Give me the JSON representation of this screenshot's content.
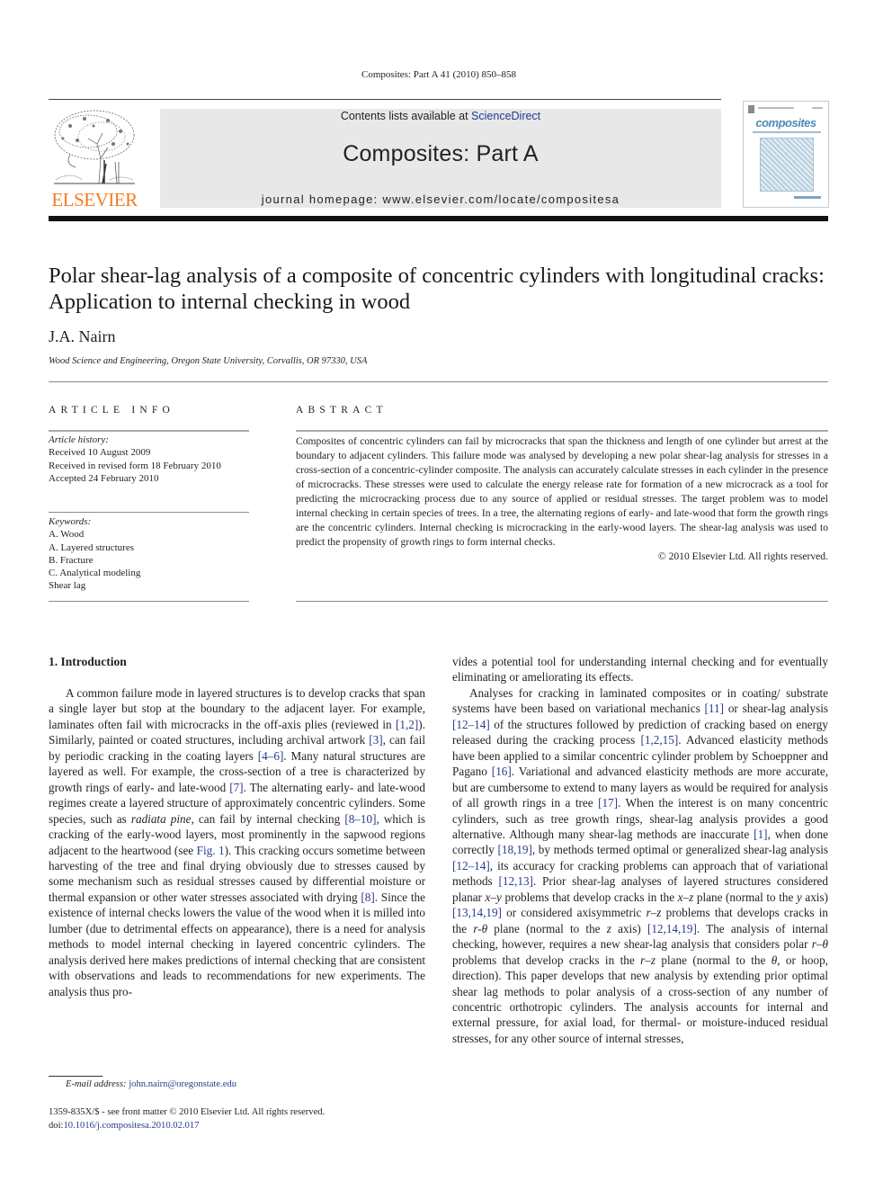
{
  "running_head": "Composites: Part A 41 (2010) 850–858",
  "header": {
    "publisher_logo_text": "ELSEVIER",
    "contents_prefix": "Contents lists available at ",
    "contents_link": "ScienceDirect",
    "journal_name": "Composites: Part A",
    "homepage": "journal homepage: www.elsevier.com/locate/compositesa",
    "cover_title": "composites",
    "colors": {
      "elsevier_orange": "#f47b20",
      "link_blue": "#2a3a8c",
      "banner_gray": "#e8e8e8"
    }
  },
  "article": {
    "title": "Polar shear-lag analysis of a composite of concentric cylinders with longitudinal cracks: Application to internal checking in wood",
    "author": "J.A. Nairn",
    "affiliation": "Wood Science and Engineering, Oregon State University, Corvallis, OR 97330, USA"
  },
  "article_info": {
    "heading": "ARTICLE INFO",
    "history_label": "Article history:",
    "history": [
      "Received 10 August 2009",
      "Received in revised form 18 February 2010",
      "Accepted 24 February 2010"
    ],
    "keywords_label": "Keywords:",
    "keywords": [
      "A. Wood",
      "A. Layered structures",
      "B. Fracture",
      "C. Analytical modeling",
      "Shear lag"
    ]
  },
  "abstract": {
    "heading": "ABSTRACT",
    "text": "Composites of concentric cylinders can fail by microcracks that span the thickness and length of one cyl­inder but arrest at the boundary to adjacent cylinders. This failure mode was analysed by developing a new polar shear-lag analysis for stresses in a cross-section of a concentric-cylinder composite. The anal­ysis can accurately calculate stresses in each cylinder in the presence of microcracks. These stresses were used to calculate the energy release rate for formation of a new microcrack as a tool for predicting the microcracking process due to any source of applied or residual stresses. The target problem was to model internal checking in certain species of trees. In a tree, the alternating regions of early- and late-wood that form the growth rings are the concentric cylinders. Internal checking is microcracking in the early-wood layers. The shear-lag analysis was used to predict the propensity of growth rings to form internal checks.",
    "copyright": "© 2010 Elsevier Ltd. All rights reserved."
  },
  "introduction": {
    "heading": "1. Introduction",
    "left_col": {
      "p1_a": "A common failure mode in layered structures is to develop cracks that span a single layer but stop at the boundary to the adja­cent layer. For example, laminates often fail with microcracks in the off-axis plies (reviewed in ",
      "ref1": "[1,2]",
      "p1_b": "). Similarly, painted or coated structures, including archival artwork ",
      "ref2": "[3]",
      "p1_c": ", can fail by periodic cracking in the coating layers ",
      "ref3": "[4–6]",
      "p1_d": ". Many natural structures are layered as well. For example, the cross-section of a tree is charac­terized by growth rings of early- and late-wood ",
      "ref4": "[7]",
      "p1_e": ". The alternating early- and late-wood regimes create a layered structure of approx­imately concentric cylinders. Some species, such as ",
      "italic1": "radiata pine",
      "p1_f": ", can fail by internal checking ",
      "ref5": "[8–10]",
      "p1_g": ", which is cracking of the early-wood layers, most prominently in the sapwood regions adja­cent to the heartwood (see ",
      "ref6": "Fig. 1",
      "p1_h": "). This cracking occurs sometime between harvesting of the tree and final drying obviously due to stresses caused by some mechanism such as residual stresses caused by differential moisture or thermal expansion or other water stresses associated with drying ",
      "ref7": "[8]",
      "p1_i": ". Since the existence of internal checks lowers the value of the wood when it is milled into lumber (due to detrimental effects on appearance), there is a need for analysis methods to model internal checking in layered concen­tric cylinders. The analysis derived here makes predictions of internal checking that are consistent with observations and leads to recommendations for new experiments. The analysis thus pro-"
    },
    "right_col": {
      "p1_cont": "vides a potential tool for understanding internal checking and for eventually eliminating or ameliorating its effects.",
      "p2_a": "Analyses for cracking in laminated composites or in coating/ substrate systems have been based on variational mechanics ",
      "r1": "[11]",
      "p2_b": " or shear-lag analysis ",
      "r2": "[12–14]",
      "p2_c": " of the structures followed by predic­tion of cracking based on energy released during the cracking pro­cess ",
      "r3": "[1,2,15]",
      "p2_d": ". Advanced elasticity methods have been applied to a similar concentric cylinder problem by Schoeppner and Pagano ",
      "r4": "[16]",
      "p2_e": ". Variational and advanced elasticity methods are more accurate, but are cumbersome to extend to many layers as would be required for analysis of all growth rings in a tree ",
      "r5": "[17]",
      "p2_f": ". When the interest is on many concentric cylinders, such as tree growth rings, shear-lag anal­ysis provides a good alternative. Although many shear-lag methods are inaccurate ",
      "r6": "[1]",
      "p2_g": ", when done correctly ",
      "r7": "[18,19]",
      "p2_h": ", by methods termed optimal or generalized shear-lag analysis ",
      "r8": "[12–14]",
      "p2_i": ", its accuracy for cracking problems can approach that of variational methods ",
      "r9": "[12,13]",
      "p2_j": ". Prior shear-lag analyses of layered structures considered planar ",
      "m1": "x–y",
      "p2_k": " problems that develop cracks in the ",
      "m2": "x–z",
      "p2_l": " plane (normal to the ",
      "m3": "y",
      "p2_m": " axis) ",
      "r10": "[13,14,19]",
      "p2_n": " or considered axisymmetric ",
      "m4": "r–z",
      "p2_o": " problems that develops cracks in the ",
      "m5": "r-θ",
      "p2_p": " plane (normal to the ",
      "m6": "z",
      "p2_q": " axis) ",
      "r11": "[12,14,19]",
      "p2_r": ". The analysis of internal checking, however, requires a new shear-lag analysis that considers polar ",
      "m7": "r–θ",
      "p2_s": " problems that devel­op cracks in the ",
      "m8": "r–z",
      "p2_t": " plane (normal to the ",
      "m9": "θ",
      "p2_u": ", or hoop, direction). This paper develops that new analysis by extending prior optimal shear lag methods to polar analysis of a cross-section of any number of concentric orthotropic cylinders. The analysis accounts for internal and external pressure, for axial load, for thermal- or moisture-in­duced residual stresses, for any other source of internal stresses,"
    }
  },
  "footnote": {
    "email_label": "E-mail address:",
    "email": "john.nairn@oregonstate.edu"
  },
  "front_matter": {
    "issn_line": "1359-835X/$ - see front matter © 2010 Elsevier Ltd. All rights reserved.",
    "doi_prefix": "doi:",
    "doi": "10.1016/j.compositesa.2010.02.017"
  }
}
